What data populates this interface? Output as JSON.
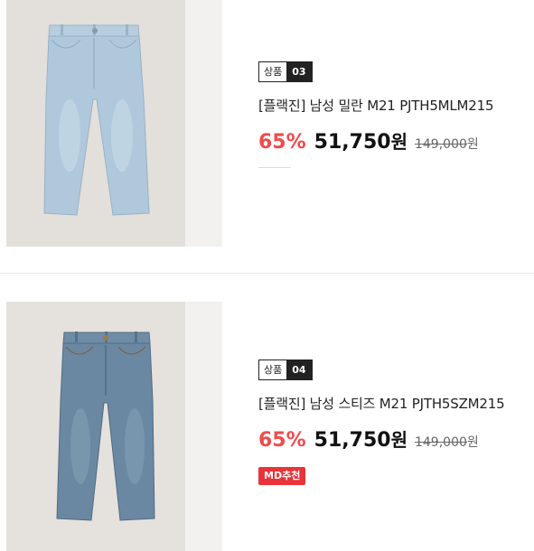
{
  "products": [
    {
      "rank_label": "상품",
      "rank_number": "03",
      "name": "[플랙진] 남성 밀란 M21 PJTH5MLM215",
      "discount": "65%",
      "sale_price": "51,750",
      "currency": "원",
      "original_price": "149,000",
      "original_currency": "원",
      "image_icon": "light-wash-jeans-image",
      "badge": ""
    },
    {
      "rank_label": "상품",
      "rank_number": "04",
      "name": "[플랙진] 남성 스티즈 M21 PJTH5SZM215",
      "discount": "65%",
      "sale_price": "51,750",
      "currency": "원",
      "original_price": "149,000",
      "original_currency": "원",
      "image_icon": "medium-wash-jeans-image",
      "badge": "MD추천"
    }
  ],
  "colors": {
    "discount": "#f04b4c",
    "badge_bg": "#e8343a",
    "light_denim": "#aec6d8",
    "medium_denim": "#6f8fa9"
  }
}
